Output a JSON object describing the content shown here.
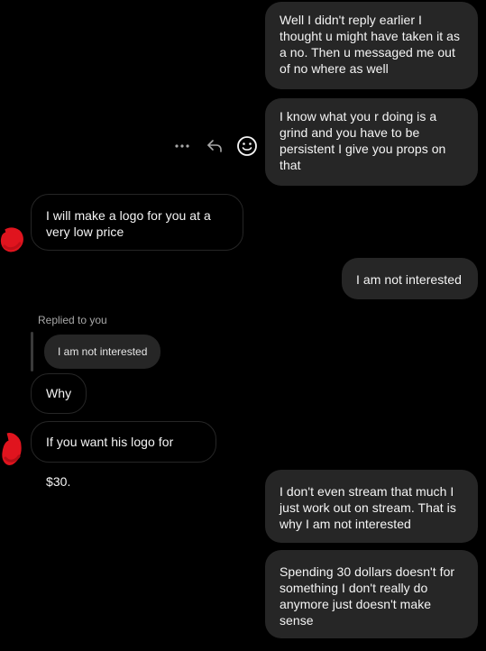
{
  "conversation": {
    "messages": [
      {
        "id": "m1",
        "direction": "sent",
        "text": "Well I didn't reply earlier I thought u might have taken it as a no. Then u messaged me out of no where as well"
      },
      {
        "id": "m2",
        "direction": "sent",
        "text": "I know what you r doing is a grind and you have to be persistent I give you props on that"
      },
      {
        "id": "m3",
        "direction": "received",
        "text": "I will make a logo for you at a very low price"
      },
      {
        "id": "m4",
        "direction": "sent",
        "text": "I am not interested"
      },
      {
        "id": "m5",
        "direction": "received",
        "text": "Why",
        "replied_label": "Replied to you",
        "reply_preview": "I am not interested"
      },
      {
        "id": "m6",
        "direction": "received",
        "text": "If you want his logo for $30."
      },
      {
        "id": "m7",
        "direction": "sent",
        "text": "I don't even stream that much I just work out on stream. That is why I am not interested"
      },
      {
        "id": "m8",
        "direction": "sent",
        "text": "Spending 30 dollars doesn't for something I don't really do anymore just doesn't make sense"
      }
    ],
    "hover_actions": [
      "more-icon",
      "reply-icon",
      "emoji-icon"
    ]
  },
  "colors": {
    "background": "#000000",
    "sent_bubble": "#262626",
    "received_border": "#262626",
    "text": "#f5f5f5",
    "secondary_text": "#a8a8a8",
    "avatar_scribble": "#e0141e"
  }
}
